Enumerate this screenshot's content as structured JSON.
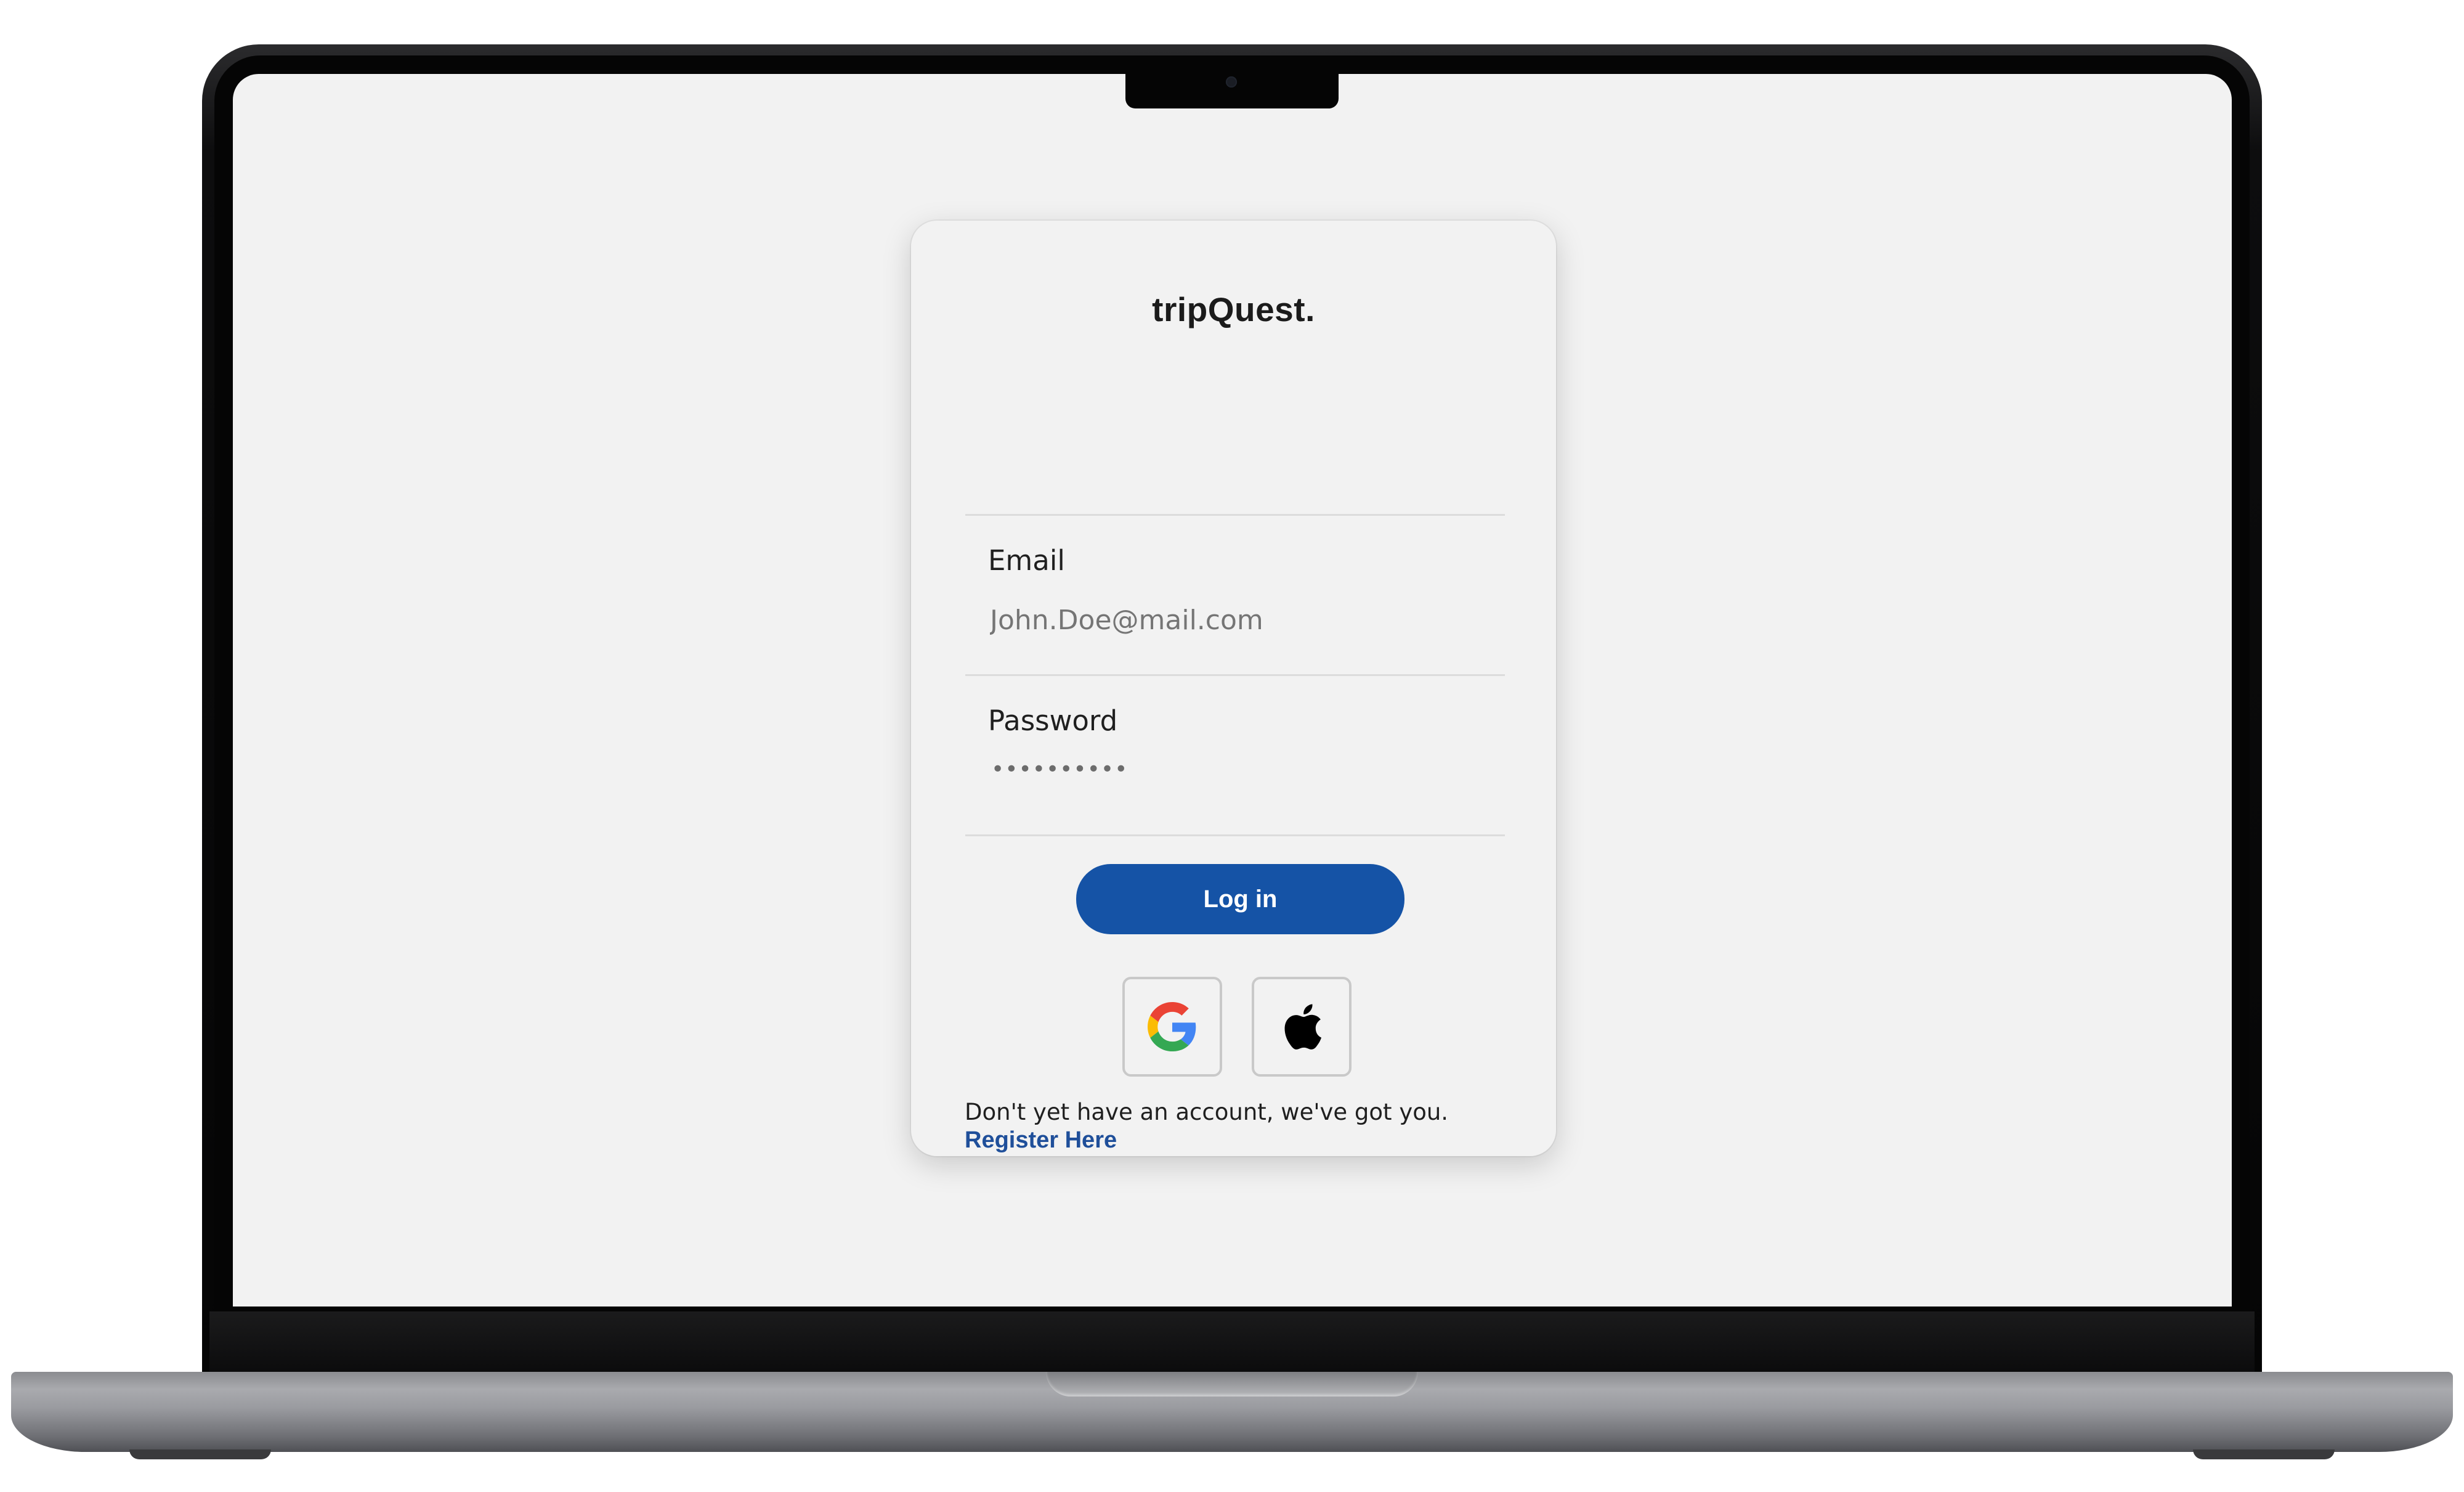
{
  "app": {
    "brand": "tripQuest."
  },
  "login_form": {
    "email_label": "Email",
    "email_placeholder": "John.Doe@mail.com",
    "password_label": "Password",
    "password_masked": "••••••••••",
    "login_button": "Log in",
    "social_logins": [
      {
        "provider": "Google",
        "icon": "google-icon"
      },
      {
        "provider": "Apple",
        "icon": "apple-icon"
      }
    ],
    "register_prompt": "Don't yet have an account, we've got you.",
    "register_link": "Register Here"
  },
  "colors": {
    "accent": "#1553a6",
    "link": "#1f4f9a",
    "background": "#f2f2f2"
  }
}
